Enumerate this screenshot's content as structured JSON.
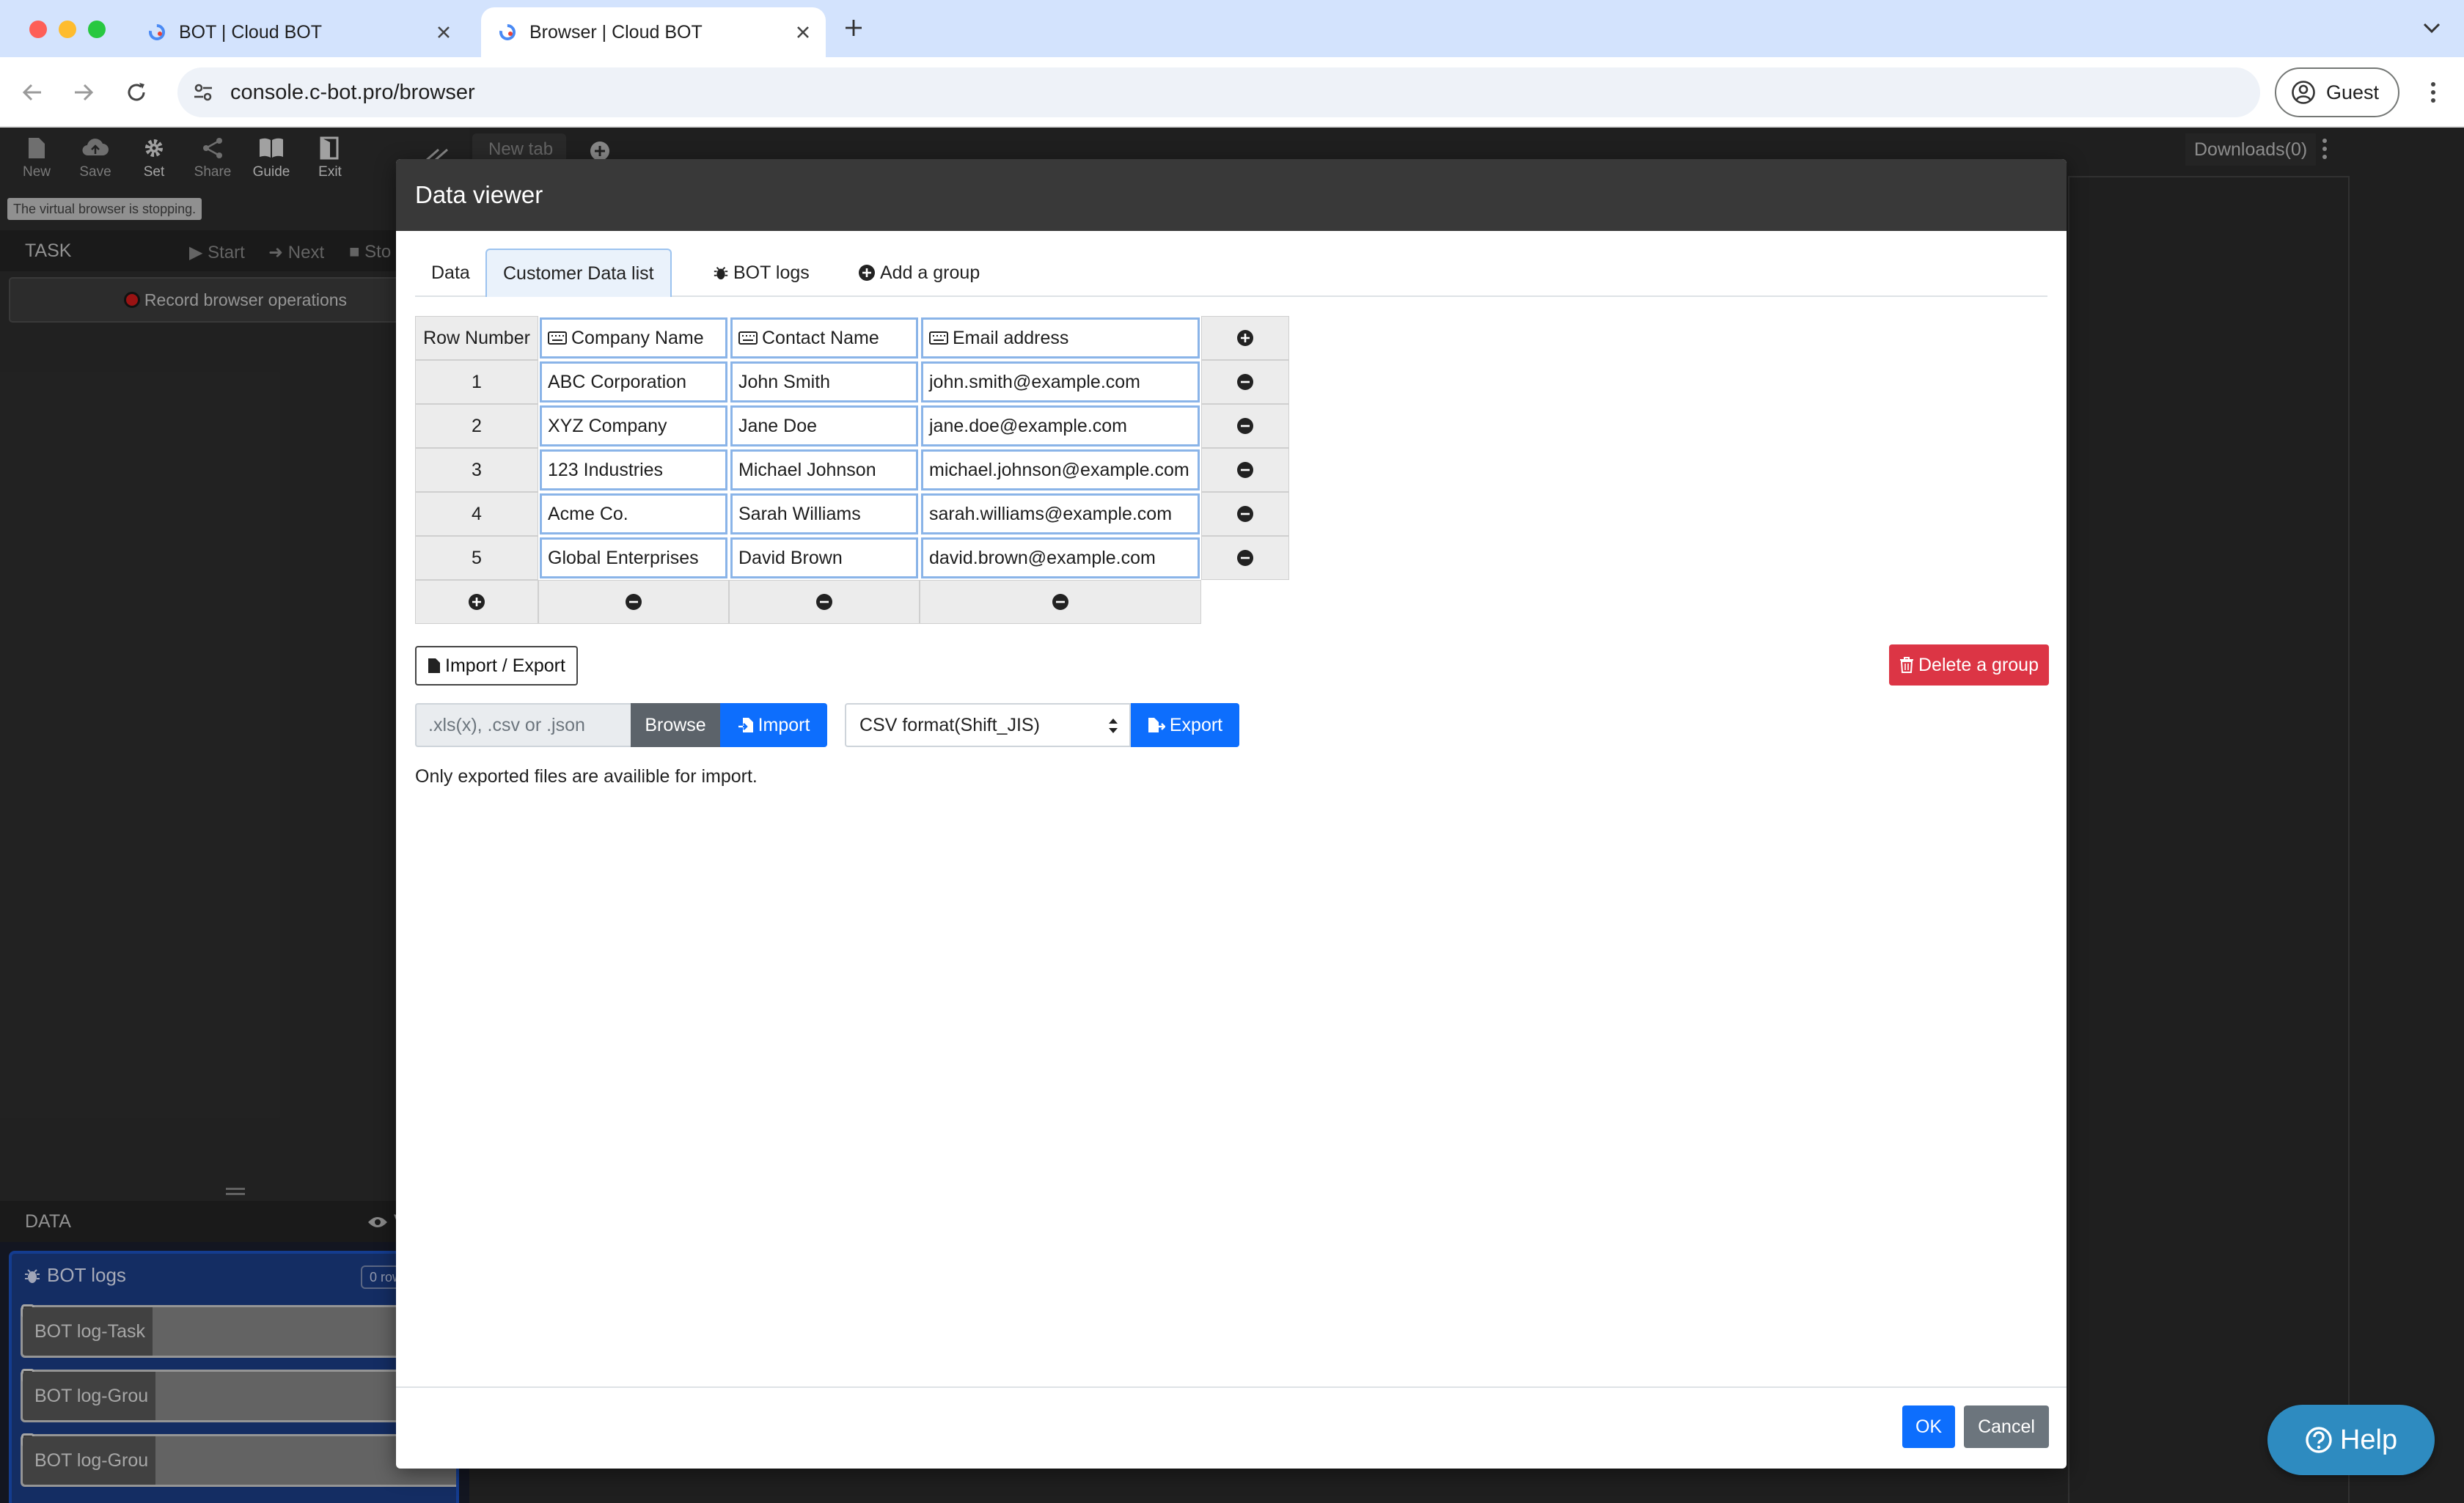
{
  "browser": {
    "tabs": [
      {
        "title": "BOT | Cloud BOT",
        "active": false
      },
      {
        "title": "Browser | Cloud BOT",
        "active": true
      }
    ],
    "url": "console.c-bot.pro/browser",
    "profile_label": "Guest"
  },
  "app": {
    "toolbar": [
      "New",
      "Save",
      "Set",
      "Share",
      "Guide",
      "Exit"
    ],
    "status_note": "The virtual browser is stopping.",
    "task": {
      "label": "TASK",
      "controls": [
        "Start",
        "Next",
        "Sto"
      ],
      "record_label": "Record browser operations"
    },
    "data": {
      "label": "DATA",
      "eye_text": "V",
      "group_name": "BOT logs",
      "rows_badge": "0 row",
      "items": [
        "BOT log-Task",
        "BOT log-Grou",
        "BOT log-Grou"
      ]
    },
    "browser_area": {
      "tab_label": "New tab",
      "downloads_label": "Downloads(0)"
    },
    "help_label": "Help"
  },
  "modal": {
    "title": "Data viewer",
    "tabs": [
      {
        "label": "Data",
        "icon": "none",
        "active": false
      },
      {
        "label": "Customer Data list",
        "icon": "none",
        "active": true
      },
      {
        "label": "BOT logs",
        "icon": "bug-icon",
        "active": false
      },
      {
        "label": "Add a group",
        "icon": "plus-circle-icon",
        "active": false
      }
    ],
    "table": {
      "row_number_header": "Row Number",
      "columns": [
        "Company Name",
        "Contact Name",
        "Email address"
      ],
      "rows": [
        {
          "num": "1",
          "cells": [
            "ABC Corporation",
            "John Smith",
            "john.smith@example.com"
          ]
        },
        {
          "num": "2",
          "cells": [
            "XYZ Company",
            "Jane Doe",
            "jane.doe@example.com"
          ]
        },
        {
          "num": "3",
          "cells": [
            "123 Industries",
            "Michael Johnson",
            "michael.johnson@example.com"
          ]
        },
        {
          "num": "4",
          "cells": [
            "Acme Co.",
            "Sarah Williams",
            "sarah.williams@example.com"
          ]
        },
        {
          "num": "5",
          "cells": [
            "Global Enterprises",
            "David Brown",
            "david.brown@example.com"
          ]
        }
      ]
    },
    "import_export_label": "Import / Export",
    "delete_group_label": "Delete a group",
    "file_placeholder": ".xls(x), .csv or .json",
    "browse_label": "Browse",
    "import_label": "Import",
    "format_selected": "CSV format(Shift_JIS)",
    "export_label": "Export",
    "import_note": "Only exported files are availible for import.",
    "ok_label": "OK",
    "cancel_label": "Cancel"
  },
  "colors": {
    "primary": "#0d6efd",
    "danger": "#dc3545",
    "secondary": "#6c757d",
    "help": "#2e8bc0",
    "modal_header": "#393939"
  }
}
